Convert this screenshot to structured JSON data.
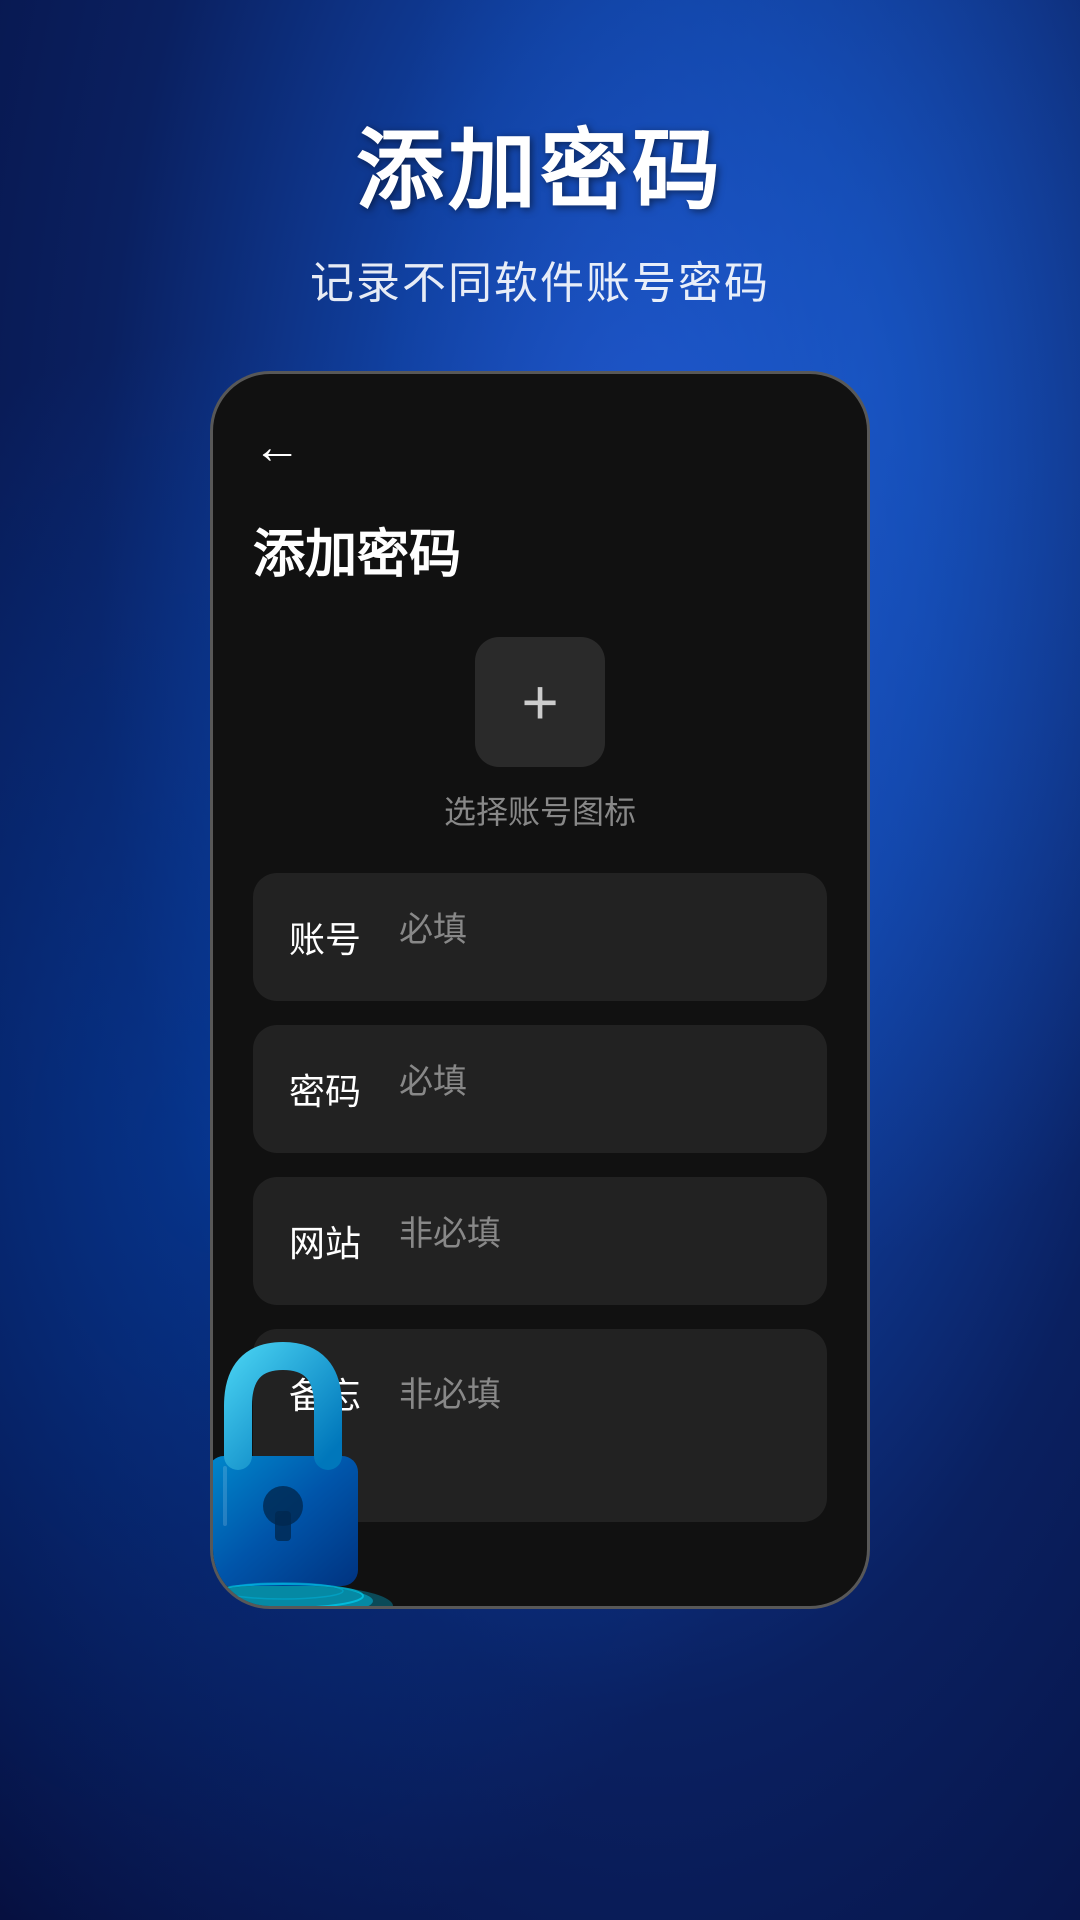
{
  "hero": {
    "title": "添加密码",
    "subtitle": "记录不同软件账号密码"
  },
  "screen": {
    "back_button_label": "←",
    "page_title": "添加密码",
    "icon_section": {
      "button_symbol": "+",
      "label": "选择账号图标"
    },
    "fields": [
      {
        "label": "账号",
        "placeholder": "必填",
        "required": true,
        "multiline": false
      },
      {
        "label": "密码",
        "placeholder": "必填",
        "required": true,
        "multiline": false
      },
      {
        "label": "网站",
        "placeholder": "非必填",
        "required": false,
        "multiline": false
      },
      {
        "label": "备忘",
        "placeholder": "非必填",
        "required": false,
        "multiline": true
      }
    ]
  },
  "colors": {
    "bg_start": "#1a3aaa",
    "bg_end": "#061040",
    "phone_bg": "#111111",
    "field_bg": "#222222",
    "text_primary": "#ffffff",
    "text_muted": "#888888",
    "icon_bg": "#2a2a2a"
  }
}
